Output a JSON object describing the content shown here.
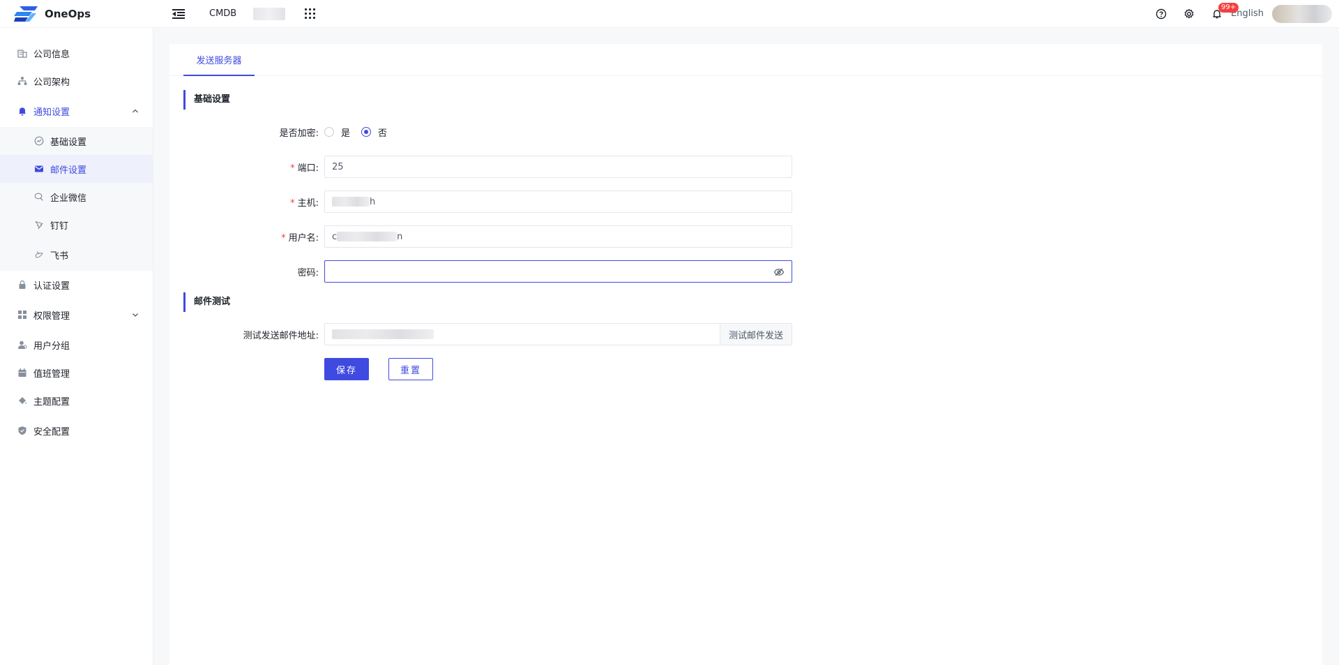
{
  "app": {
    "name": "OneOps",
    "top_app": "CMDB",
    "language": "English",
    "notification_badge": "99+",
    "accent_color": "#3f4ae0"
  },
  "sidebar": {
    "items": [
      {
        "label": "公司信息",
        "icon": "building-icon"
      },
      {
        "label": "公司架构",
        "icon": "org-tree-icon"
      },
      {
        "label": "通知设置",
        "icon": "bell-icon",
        "expanded": true,
        "children": [
          {
            "label": "基础设置",
            "icon": "speedometer-icon"
          },
          {
            "label": "邮件设置",
            "icon": "mail-icon",
            "active": true
          },
          {
            "label": "企业微信",
            "icon": "wechat-icon"
          },
          {
            "label": "钉钉",
            "icon": "dingtalk-icon"
          },
          {
            "label": "飞书",
            "icon": "feishu-icon"
          }
        ]
      },
      {
        "label": "认证设置",
        "icon": "lock-icon"
      },
      {
        "label": "权限管理",
        "icon": "grid-icon",
        "expandable": true
      },
      {
        "label": "用户分组",
        "icon": "user-group-icon"
      },
      {
        "label": "值班管理",
        "icon": "calendar-icon"
      },
      {
        "label": "主题配置",
        "icon": "paint-bucket-icon"
      },
      {
        "label": "安全配置",
        "icon": "shield-icon"
      }
    ]
  },
  "main": {
    "tab": "发送服务器",
    "section_basic": "基础设置",
    "section_test": "邮件测试",
    "form": {
      "encrypt_label": "是否加密:",
      "encrypt_yes": "是",
      "encrypt_no": "否",
      "encrypt_selected": "否",
      "port_label": "端口:",
      "port_value": "25",
      "host_label": "主机:",
      "host_value_visible": "h",
      "username_label": "用户名:",
      "username_value_prefix": "c",
      "username_value_suffix": "n",
      "password_label": "密码:",
      "password_value": "",
      "test_label": "测试发送邮件地址:",
      "test_button": "测试邮件发送",
      "save_button": "保存",
      "reset_button": "重置"
    }
  }
}
